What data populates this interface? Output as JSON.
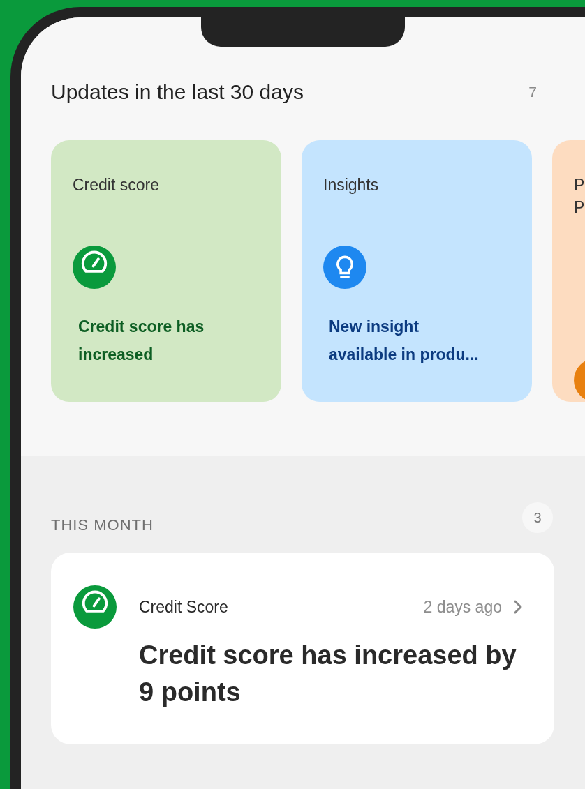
{
  "updates": {
    "title": "Updates in the last 30 days",
    "count": "7",
    "cards": [
      {
        "kind": "credit_score",
        "color": "#0a9a3c",
        "title_lines": [
          "Credit score"
        ],
        "message_lines": [
          "Credit score has",
          "increased"
        ]
      },
      {
        "kind": "insight",
        "color": "#1e88f0",
        "title_lines": [
          "Insights"
        ],
        "message_lines": [
          "New insight",
          "available in produ..."
        ]
      },
      {
        "kind": "other",
        "color": "#e8800f",
        "title_lines": [
          "P",
          "P"
        ]
      }
    ]
  },
  "this_month": {
    "title": "THIS MONTH",
    "count": "3",
    "items": [
      {
        "kind": "credit_score",
        "color": "#0a9a3c",
        "category": "Credit Score",
        "time": "2 days ago",
        "headline": "Credit score has increased by 9 points"
      }
    ]
  }
}
